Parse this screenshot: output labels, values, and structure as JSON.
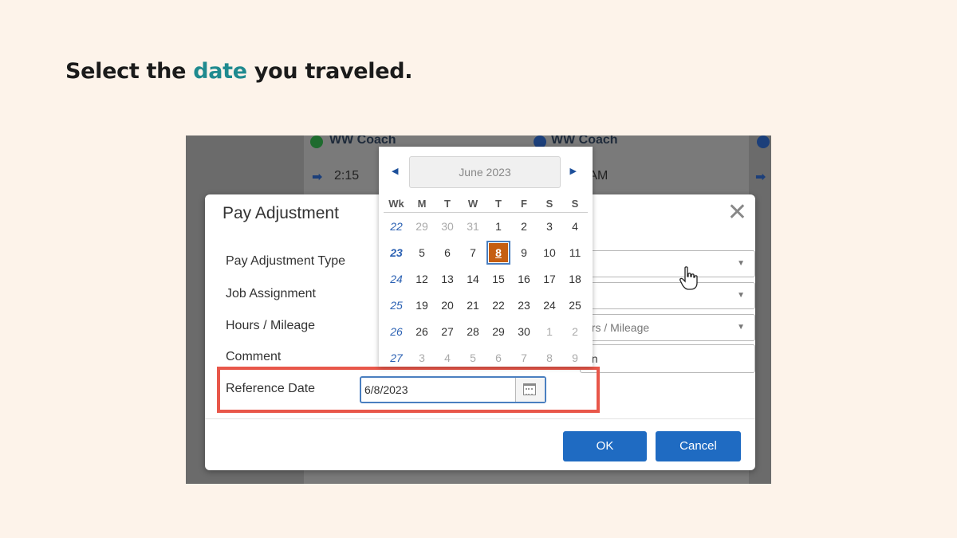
{
  "heading": {
    "prefix": "Select the",
    "highlight": "date",
    "suffix": "you traveled."
  },
  "background": {
    "left_title": "WW Coach",
    "right_title": "WW Coach",
    "left_time": "2:15",
    "right_time": "00 AM"
  },
  "modal": {
    "title": "Pay Adjustment",
    "close_label": "✕",
    "fields": {
      "pay_adjustment_type": "Pay Adjustment Type",
      "job_assignment": "Job Assignment",
      "hours_mileage": "Hours / Mileage",
      "comment": "Comment",
      "reference_date": "Reference Date"
    },
    "hours_mileage_value": "urs / Mileage",
    "comment_value": "on",
    "reference_date_value": "6/8/2023",
    "ok_label": "OK",
    "cancel_label": "Cancel"
  },
  "calendar": {
    "month": "June 2023",
    "headers": [
      "Wk",
      "M",
      "T",
      "W",
      "T",
      "F",
      "S",
      "S"
    ],
    "weeks": [
      {
        "wk": "22",
        "days": [
          "29",
          "30",
          "31",
          "1",
          "2",
          "3",
          "4"
        ],
        "other": [
          0,
          1,
          2
        ]
      },
      {
        "wk": "23",
        "days": [
          "5",
          "6",
          "7",
          "8",
          "9",
          "10",
          "11"
        ],
        "other": []
      },
      {
        "wk": "24",
        "days": [
          "12",
          "13",
          "14",
          "15",
          "16",
          "17",
          "18"
        ],
        "other": []
      },
      {
        "wk": "25",
        "days": [
          "19",
          "20",
          "21",
          "22",
          "23",
          "24",
          "25"
        ],
        "other": []
      },
      {
        "wk": "26",
        "days": [
          "26",
          "27",
          "28",
          "29",
          "30",
          "1",
          "2"
        ],
        "other": [
          5,
          6
        ]
      },
      {
        "wk": "27",
        "days": [
          "3",
          "4",
          "5",
          "6",
          "7",
          "8",
          "9"
        ],
        "other": [
          0,
          1,
          2,
          3,
          4,
          5,
          6
        ]
      }
    ],
    "selected_day": "8",
    "current_week": "23"
  },
  "colors": {
    "accent_text": "#1f8a8f",
    "selected_day": "#c55e12",
    "button_blue": "#1f6bc2",
    "highlight_red": "#e8574a"
  }
}
